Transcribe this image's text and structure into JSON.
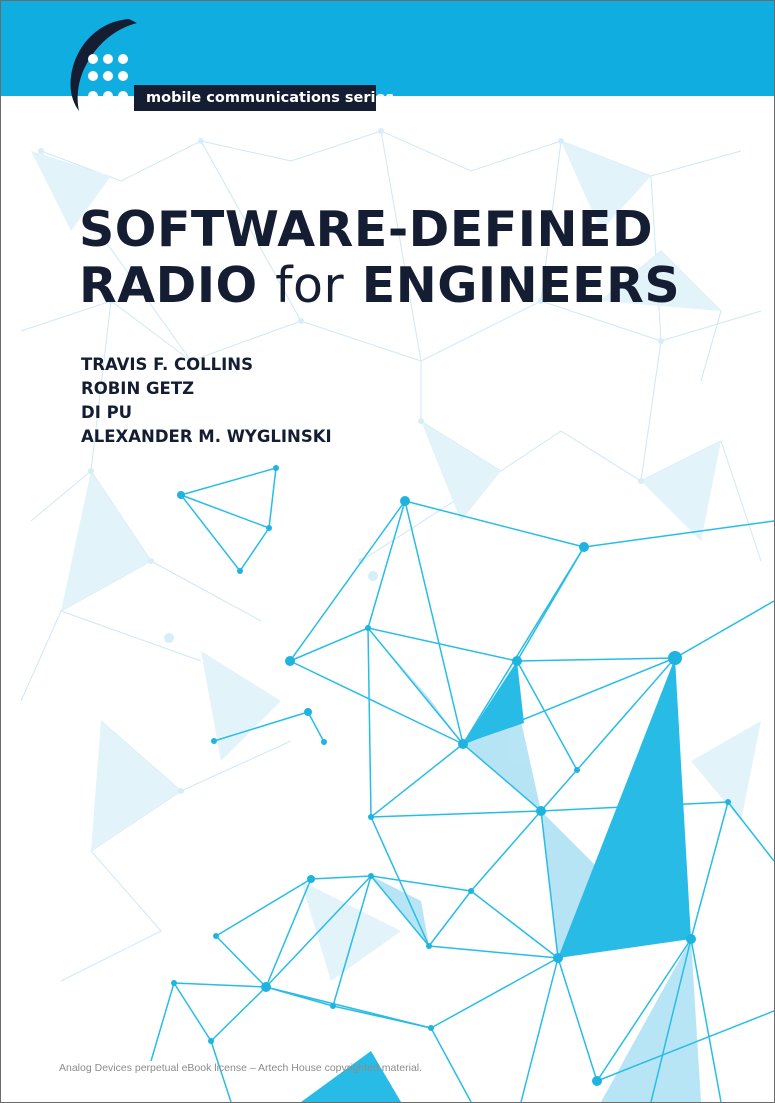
{
  "header": {
    "series_label": "mobile communications series",
    "band_color": "#10ade0",
    "box_color": "#151d33",
    "logo_icon": "dot-grid-swoosh-logo"
  },
  "title": {
    "line1": "SOFTWARE-DEFINED",
    "line2_part1": "RADIO",
    "line2_part2": "for",
    "line2_part3": "ENGINEERS"
  },
  "authors": [
    "TRAVIS F. COLLINS",
    "ROBIN GETZ",
    "DI PU",
    "ALEXANDER M. WYGLINSKI"
  ],
  "footer": {
    "license_text": "Analog Devices perpetual eBook license – Artech House copyrighted material."
  },
  "colors": {
    "text_dark": "#151d33",
    "network_blue": "#28bde6",
    "network_light": "#d6eef8"
  },
  "graphics": {
    "background_icon": "polygonal-network-graphic"
  }
}
